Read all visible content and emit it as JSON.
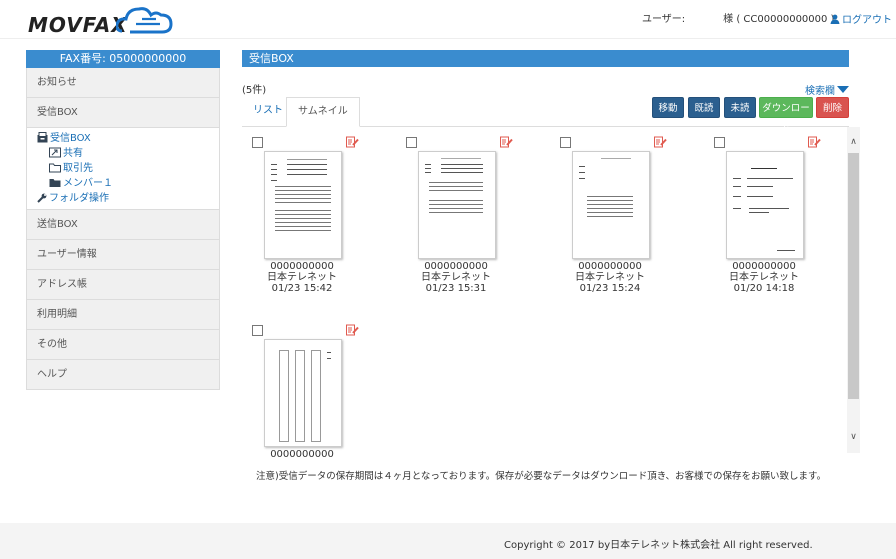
{
  "header": {
    "logo_text": "MOVFAX",
    "user_label": "ユーザー:",
    "user_name": "様 ( CC00000000000 )",
    "logout_label": "ログアウト"
  },
  "sidebar": {
    "fax_number": "FAX番号: 05000000000",
    "items_top": [
      {
        "label": "お知らせ"
      },
      {
        "label": "受信BOX"
      }
    ],
    "tree": [
      {
        "label": "受信BOX",
        "icon": "inbox-icon",
        "level": 1
      },
      {
        "label": "共有",
        "icon": "shared-folder-icon",
        "level": 2
      },
      {
        "label": "取引先",
        "icon": "folder-outline-icon",
        "level": 2
      },
      {
        "label": "メンバー１",
        "icon": "folder-filled-icon",
        "level": 2
      },
      {
        "label": "フォルダ操作",
        "icon": "wrench-icon",
        "level": 1
      }
    ],
    "items_bottom": [
      {
        "label": "送信BOX"
      },
      {
        "label": "ユーザー情報"
      },
      {
        "label": "アドレス帳"
      },
      {
        "label": "利用明細"
      },
      {
        "label": "その他"
      },
      {
        "label": "ヘルプ"
      }
    ]
  },
  "main": {
    "title": "受信BOX",
    "count": "(5件)",
    "search_toggle": "検索欄",
    "tabs": [
      {
        "label": "リスト"
      },
      {
        "label": "サムネイル"
      }
    ],
    "actions": {
      "move": "移動",
      "read": "既読",
      "unread": "未読",
      "download": "ダウンロード",
      "delete": "削除"
    },
    "faxes": [
      {
        "number": "0000000000",
        "sender": "日本テレネット",
        "time": "01/23 15:42"
      },
      {
        "number": "0000000000",
        "sender": "日本テレネット",
        "time": "01/23 15:31"
      },
      {
        "number": "0000000000",
        "sender": "日本テレネット",
        "time": "01/23 15:24"
      },
      {
        "number": "0000000000",
        "sender": "日本テレネット",
        "time": "01/20 14:18"
      },
      {
        "number": "0000000000",
        "sender": "",
        "time": ""
      }
    ],
    "notice": "注意)受信データの保存期間は４ヶ月となっております。保存が必要なデータはダウンロード頂き、お客様での保存をお願い致します。"
  },
  "footer": {
    "copyright": "Copyright © 2017 by日本テレネット株式会社 All right reserved."
  },
  "colors": {
    "accent_blue": "#3a8ccf",
    "button_blue": "#2b5f8f",
    "button_green": "#5cb85c",
    "button_red": "#d9534f",
    "link": "#1a6fb5"
  }
}
